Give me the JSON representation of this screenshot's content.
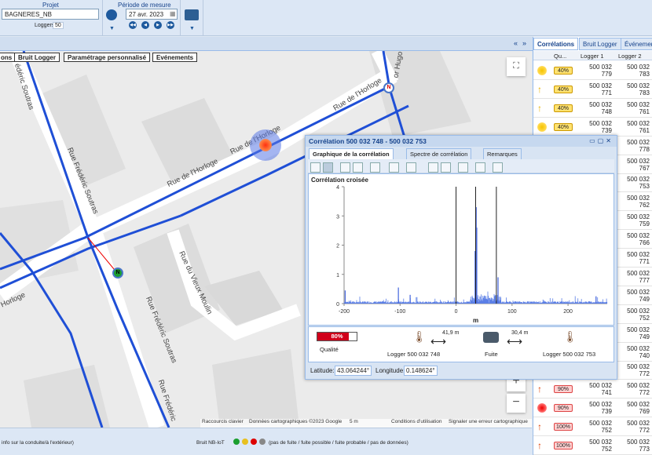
{
  "toolbar": {
    "project_label": "Projet",
    "project_value": "BAGNERES_NB",
    "loggers_label": "Loggers:",
    "loggers_count": "50",
    "period_label": "Période de mesure",
    "period_date": "27 avr. 2023"
  },
  "map_tabs": [
    "ons",
    "Bruit Logger",
    "Paramétrage personnalisé",
    "Evénements"
  ],
  "streets": {
    "horloge1": "Rue de l'Horloge",
    "horloge2": "Rue de l'Horloge",
    "horloge3": "Rue de l'Horloge",
    "horloge4": "Horloge",
    "soutras1": "Rue Frédéric Soutras",
    "soutras2": "Rue Frédéric Soutras",
    "soutras3": "édéric Soutras",
    "soutras4": "Rue Frédéric",
    "vieux_moulin": "Rue du Vieux Moulin",
    "hugo": "or Hugo"
  },
  "map_attribution": {
    "shortcuts": "Raccourcis clavier",
    "data": "Données cartographiques ©2023 Google",
    "scale": "5 m",
    "terms": "Conditions d'utilisation",
    "report": "Signaler une erreur cartographique"
  },
  "statusbar": {
    "left_text": "info sur la conduite/à l'extérieur)",
    "bruit_label": "Bruit NB-IoT",
    "legend_text": "(pas de fuite / fuite possible / fuite probable / pas de données)"
  },
  "right_panel": {
    "tabs": [
      "Corrélations",
      "Bruit Logger",
      "Événemen"
    ],
    "columns": [
      "Qu...",
      "Logger 1",
      "Logger 2"
    ],
    "rows": [
      {
        "icon": "sun",
        "quality": "40%",
        "l1": "500 032\n779",
        "l2": "500 032\n783"
      },
      {
        "icon": "arrow",
        "quality": "40%",
        "l1": "500 032\n771",
        "l2": "500 032\n783"
      },
      {
        "icon": "arrow",
        "quality": "40%",
        "l1": "500 032\n748",
        "l2": "500 032\n761"
      },
      {
        "icon": "sun",
        "quality": "40%",
        "l1": "500 032\n739",
        "l2": "500 032\n761"
      },
      {
        "icon": "",
        "quality": "",
        "l1": "",
        "l2": "500 032\n778"
      },
      {
        "icon": "",
        "quality": "",
        "l1": "",
        "l2": "500 032\n767"
      },
      {
        "icon": "",
        "quality": "",
        "l1": "",
        "l2": "500 032\n753"
      },
      {
        "icon": "",
        "quality": "",
        "l1": "",
        "l2": "500 032\n762"
      },
      {
        "icon": "",
        "quality": "",
        "l1": "",
        "l2": "500 032\n759"
      },
      {
        "icon": "",
        "quality": "",
        "l1": "",
        "l2": "500 032\n766"
      },
      {
        "icon": "",
        "quality": "",
        "l1": "",
        "l2": "500 032\n771"
      },
      {
        "icon": "",
        "quality": "",
        "l1": "",
        "l2": "500 032\n777"
      },
      {
        "icon": "",
        "quality": "",
        "l1": "",
        "l2": "500 032\n749"
      },
      {
        "icon": "",
        "quality": "",
        "l1": "",
        "l2": "500 032\n752"
      },
      {
        "icon": "",
        "quality": "",
        "l1": "",
        "l2": "500 032\n749"
      },
      {
        "icon": "",
        "quality": "",
        "l1": "",
        "l2": "500 032\n740"
      },
      {
        "icon": "",
        "quality": "",
        "l1": "",
        "l2": "500 032\n772"
      },
      {
        "icon": "arrow-red",
        "quality": "90%",
        "l1": "500 032\n741",
        "l2": "500 032\n772"
      },
      {
        "icon": "sun-red",
        "quality": "90%",
        "l1": "500 032\n739",
        "l2": "500 032\n769"
      },
      {
        "icon": "arrow-red",
        "quality": "100%",
        "l1": "500 032\n752",
        "l2": "500 032\n772"
      },
      {
        "icon": "arrow-red",
        "quality": "100%",
        "l1": "500 032\n752",
        "l2": "500 032\n773"
      }
    ]
  },
  "window": {
    "title": "Corrélation 500 032 748 - 500 032 753",
    "tabs": [
      "Graphique de la corrélation",
      "Spectre de corrélation",
      "Remarques"
    ],
    "plot_title": "Corrélation croisée",
    "quality_label": "Qualité",
    "quality_value": "80%",
    "quality_fraction": 0.8,
    "logger1_label": "Logger 500 032 748",
    "logger2_label": "Logger 500 032 753",
    "fuite_label": "Fuite",
    "dist1": "41,9 m",
    "dist2": "30,4 m",
    "lat_label": "Latitude:",
    "lat_value": "43.064244°",
    "lon_label": "Longitude:",
    "lon_value": "0.148624°"
  },
  "chart_data": {
    "type": "line",
    "title": "Corrélation croisée",
    "xlabel": "m",
    "ylabel": "",
    "xlim": [
      -200,
      270
    ],
    "ylim": [
      0,
      4
    ],
    "xticks": [
      -200,
      -100,
      0,
      100,
      200
    ],
    "yticks": [
      0,
      1,
      2,
      3,
      4
    ],
    "markers": [
      0,
      35,
      72
    ],
    "peaks": [
      {
        "x": 36,
        "y": 3.3
      },
      {
        "x": 37,
        "y": 2.6
      },
      {
        "x": 34,
        "y": 1.8
      },
      {
        "x": 75,
        "y": 0.9
      },
      {
        "x": -103,
        "y": 0.55
      },
      {
        "x": -198,
        "y": 0.45
      },
      {
        "x": -82,
        "y": 0.3
      },
      {
        "x": 250,
        "y": 0.25
      }
    ]
  }
}
